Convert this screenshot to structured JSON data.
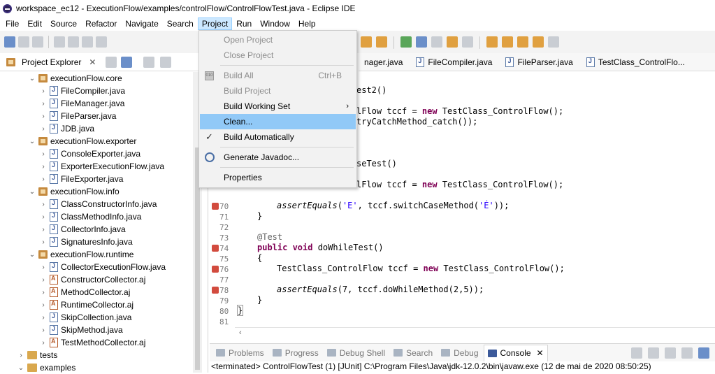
{
  "window": {
    "title": "workspace_ec12 - ExecutionFlow/examples/controlFlow/ControlFlowTest.java - Eclipse IDE"
  },
  "menubar": {
    "items": [
      "File",
      "Edit",
      "Source",
      "Refactor",
      "Navigate",
      "Search",
      "Project",
      "Run",
      "Window",
      "Help"
    ],
    "active": "Project"
  },
  "project_menu": {
    "open_project": "Open Project",
    "close_project": "Close Project",
    "build_all": "Build All",
    "build_all_shortcut": "Ctrl+B",
    "build_project": "Build Project",
    "build_working_set": "Build Working Set",
    "clean": "Clean...",
    "build_automatically": "Build Automatically",
    "generate_javadoc": "Generate Javadoc...",
    "properties": "Properties"
  },
  "explorer": {
    "title": "Project Explorer",
    "rows": [
      "executionFlow.core",
      "FileCompiler.java",
      "FileManager.java",
      "FileParser.java",
      "JDB.java",
      "executionFlow.exporter",
      "ConsoleExporter.java",
      "ExporterExecutionFlow.java",
      "FileExporter.java",
      "executionFlow.info",
      "ClassConstructorInfo.java",
      "ClassMethodInfo.java",
      "CollectorInfo.java",
      "SignaturesInfo.java",
      "executionFlow.runtime",
      "CollectorExecutionFlow.java",
      "ConstructorCollector.aj",
      "MethodCollector.aj",
      "RuntimeCollector.aj",
      "SkipCollection.java",
      "SkipMethod.java",
      "TestMethodCollector.aj",
      "tests",
      "examples"
    ]
  },
  "editor_tabs": [
    "nager.java",
    "FileCompiler.java",
    "FileParser.java",
    "TestClass_ControlFlo..."
  ],
  "code": {
    "frag1": "est2()",
    "frag2": "lFlow tccf = ",
    "frag2_kw": "new",
    "frag2_rest": " TestClass_ControlFlow();",
    "frag3": "tryCatchMethod_catch());",
    "frag4": "seTest()",
    "frag5": "lFlow tccf = ",
    "frag5_kw": "new",
    "frag5_rest": " TestClass_ControlFlow();",
    "line70": "assertEquals",
    "line70_rest1": "(",
    "line70_s1": "'E'",
    "line70_rest2": ", tccf.switchCaseMethod(",
    "line70_s2": "'É'",
    "line70_rest3": "));",
    "close_brace": "}",
    "ann": "@Test",
    "line74_kw": "public void",
    "line74_rest": " doWhileTest()",
    "open_brace": "{",
    "line76": "TestClass_ControlFlow tccf = ",
    "line76_kw": "new",
    "line76_rest": " TestClass_ControlFlow();",
    "line78": "assertEquals",
    "line78_rest": "(7, tccf.doWhileMethod(2,5));",
    "line80": "}"
  },
  "line_numbers": [
    "70",
    "71",
    "72",
    "73",
    "74",
    "75",
    "76",
    "77",
    "78",
    "79",
    "80",
    "81"
  ],
  "bottom_tabs": [
    "Problems",
    "Progress",
    "Debug Shell",
    "Search",
    "Debug",
    "Console"
  ],
  "bottom_active": "Console",
  "console_status": "<terminated> ControlFlowTest (1) [JUnit] C:\\Program Files\\Java\\jdk-12.0.2\\bin\\javaw.exe (12 de mai de 2020 08:50:25)"
}
